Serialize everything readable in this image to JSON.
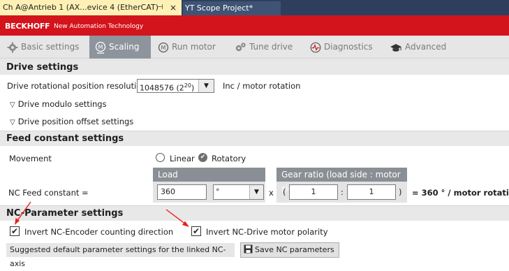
{
  "doc_tabs": {
    "active_label": "Ch A@Antrieb 1 (AX...evice 4 (EtherCAT)",
    "pin_glyph": "⊣",
    "close_glyph": "×",
    "inactive_label": "YT Scope Project*"
  },
  "brand": {
    "logo": "BECKHOFF",
    "tagline": "New Automation Technology",
    "color": "#d4141c"
  },
  "function_tabs": [
    {
      "label": "Basic settings",
      "icon": "gear-icon",
      "active": false
    },
    {
      "label": "Scaling",
      "icon": "motor-m-icon",
      "active": true
    },
    {
      "label": "Run motor",
      "icon": "motor-m-icon",
      "active": false
    },
    {
      "label": "Tune drive",
      "icon": "gears-icon",
      "active": false
    },
    {
      "label": "Diagnostics",
      "icon": "heartbeat-icon",
      "active": false
    },
    {
      "label": "Advanced",
      "icon": "graduation-cap-icon",
      "active": false
    }
  ],
  "drive_settings": {
    "title": "Drive settings",
    "resolution_label": "Drive rotational position resolution",
    "resolution_value": "1048576 (2",
    "resolution_exp": "20",
    "resolution_value_end": ")",
    "resolution_unit": "Inc / motor rotation",
    "modulo_label": "Drive modulo settings",
    "offset_label": "Drive position offset settings"
  },
  "feed_constant": {
    "title": "Feed constant settings",
    "movement_label": "Movement",
    "movement_options": [
      "Linear",
      "Rotatory"
    ],
    "movement_selected": "Rotatory",
    "load_header": "Load",
    "gear_header": "Gear ratio (load side : motor side)",
    "nc_feed_label": "NC Feed constant =",
    "load_value": "360",
    "unit_value": "°",
    "multiply": "x",
    "paren_open": "(",
    "colon": ":",
    "paren_close": ")",
    "gear_load": "1",
    "gear_motor": "1",
    "result": "= 360 ° / motor rotation"
  },
  "nc_parameters": {
    "title": "NC-Parameter settings",
    "invert_encoder_label": "Invert NC-Encoder counting direction",
    "invert_encoder_checked": true,
    "invert_drive_label": "Invert NC-Drive motor polarity",
    "invert_drive_checked": true,
    "suggest_label": "Suggested default parameter settings for the linked NC-axis",
    "save_button_label": "Save NC parameters",
    "check_glyph": "✔",
    "annotation_color": "#e8201a"
  }
}
